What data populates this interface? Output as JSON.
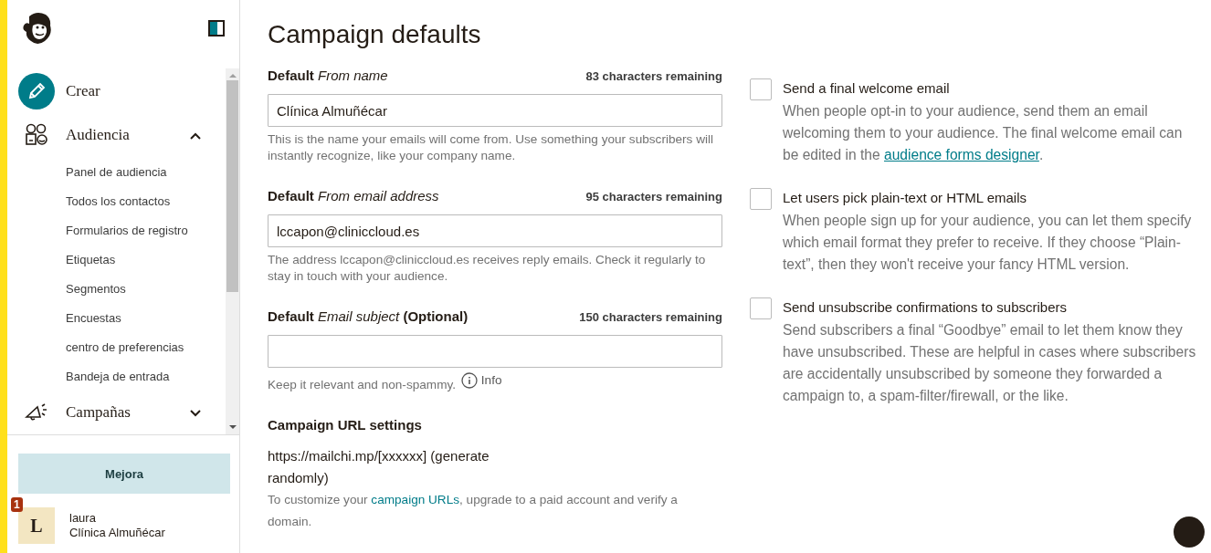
{
  "sidebar": {
    "nav": [
      {
        "label": "Crear"
      },
      {
        "label": "Audiencia",
        "expanded": true,
        "children": [
          {
            "label": "Panel de audiencia"
          },
          {
            "label": "Todos los contactos"
          },
          {
            "label": "Formularios de registro"
          },
          {
            "label": "Etiquetas"
          },
          {
            "label": "Segmentos"
          },
          {
            "label": "Encuestas"
          },
          {
            "label": "centro de preferencias"
          },
          {
            "label": "Bandeja de entrada"
          }
        ]
      },
      {
        "label": "Campañas",
        "expanded": false
      }
    ],
    "upgrade_button": "Mejora",
    "user": {
      "initial": "L",
      "badge": "1",
      "name": "laura",
      "organization": "Clínica Almuñécar"
    }
  },
  "main": {
    "title": "Campaign defaults",
    "fields": [
      {
        "label": "Default *From name*",
        "remaining": "83 characters remaining",
        "value": "Clínica Almuñécar",
        "help": "This is the name your emails will come from. Use something your subscribers will instantly recognize, like your company name."
      },
      {
        "label": "Default *From email address*",
        "remaining": "95 characters remaining",
        "value": "lccapon@cliniccloud.es",
        "help": "The address lccapon@cliniccloud.es receives reply emails. Check it regularly to stay in touch with your audience."
      },
      {
        "label": "Default *Email subject* (Optional)",
        "remaining": "150 characters remaining",
        "help": "Keep it relevant and non-spammy.",
        "info_link": "Info"
      }
    ],
    "url_settings": {
      "heading": "Campaign URL settings",
      "url": "https://mailchi.mp/[xxxxxx] (generate randomly)",
      "note": [
        {
          "kind": "text",
          "text": "To customize your "
        },
        {
          "kind": "link",
          "text": "campaign URLs"
        },
        {
          "kind": "text",
          "text": ", upgrade to a paid account and verify a domain."
        }
      ]
    },
    "options": [
      {
        "title": "Send a final welcome email",
        "checked": false,
        "description": [
          {
            "kind": "text",
            "text": "When people opt-in to your audience, send them an email welcoming them to your audience. The final welcome email can be edited in the "
          },
          {
            "kind": "link",
            "text": "audience forms designer"
          },
          {
            "kind": "text",
            "text": "."
          }
        ]
      },
      {
        "title": "Let users pick plain-text or HTML emails",
        "checked": false,
        "description": [
          {
            "kind": "text",
            "text": "When people sign up for your audience, you can let them specify which email format they prefer to receive. If they choose “Plain-text”, then they won't receive your fancy HTML version."
          }
        ]
      },
      {
        "title": "Send unsubscribe confirmations to subscribers",
        "checked": false,
        "description": [
          {
            "kind": "text",
            "text": "Send subscribers a final “Goodbye” email to let them know they have unsubscribed. These are helpful in cases where subscribers are accidentally unsubscribed by someone they forwarded a campaign to, a spam-filter/firewall, or the like."
          }
        ]
      }
    ]
  }
}
